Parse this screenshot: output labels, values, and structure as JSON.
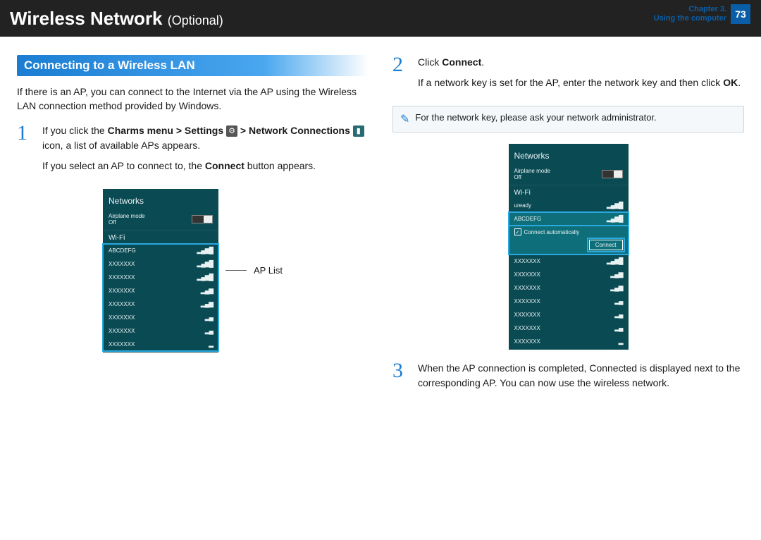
{
  "header": {
    "title_main": "Wireless Network",
    "title_suffix": "(Optional)",
    "chapter_line1": "Chapter 3.",
    "chapter_line2": "Using the computer",
    "page_number": "73"
  },
  "section_heading": "Connecting to a Wireless LAN",
  "intro": "If there is an AP, you can connect to the Internet via the AP using the Wireless LAN connection method provided by Windows.",
  "step1": {
    "num": "1",
    "p1a": "If you click the ",
    "p1b_bold": "Charms menu > Settings",
    "p1c": " ",
    "p1d_bold": " > Network Connections",
    "p1e": " icon, a list of available APs appears.",
    "p2a": "If you select an AP to connect to, the ",
    "p2b_bold": "Connect",
    "p2c": " button appears."
  },
  "ap_list_label": "AP List",
  "panel1": {
    "title": "Networks",
    "airplane_label": "Airplane mode",
    "off_label": "Off",
    "wifi_label": "Wi-Fi",
    "items": [
      "ABCDEFG",
      "XXXXXXX",
      "XXXXXXX",
      "XXXXXXX",
      "XXXXXXX",
      "XXXXXXX",
      "XXXXXXX",
      "XXXXXXX"
    ]
  },
  "step2": {
    "num": "2",
    "p1a": "Click ",
    "p1b_bold": "Connect",
    "p1c": ".",
    "p2a": "If a network key is set for the AP, enter the network key and then click ",
    "p2b_bold": "OK",
    "p2c": "."
  },
  "note": "For the network key, please ask your network administrator.",
  "panel2": {
    "title": "Networks",
    "airplane_label": "Airplane mode",
    "off_label": "Off",
    "wifi_label": "Wi-Fi",
    "uready": "uready",
    "selected": "ABCDEFG",
    "auto_label": "Connect automatically",
    "connect_btn": "Connect",
    "rest": [
      "XXXXXXX",
      "XXXXXXX",
      "XXXXXXX",
      "XXXXXXX",
      "XXXXXXX",
      "XXXXXXX",
      "XXXXXXX"
    ]
  },
  "step3": {
    "num": "3",
    "text": "When the AP connection is completed, Connected is displayed next to the corresponding AP. You can now use the wireless network."
  }
}
